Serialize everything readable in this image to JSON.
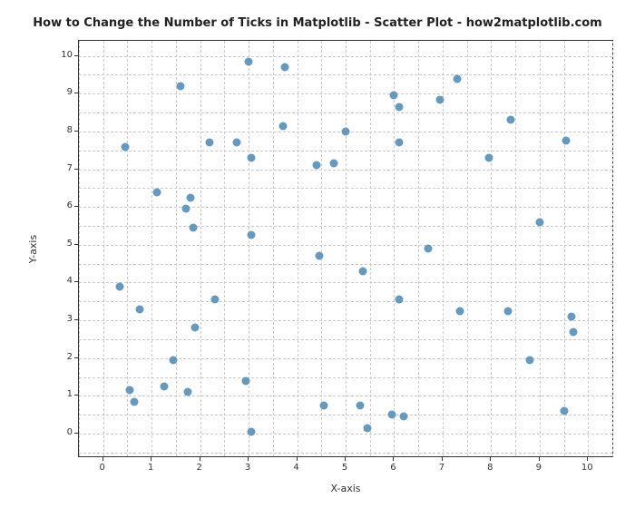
{
  "chart_data": {
    "type": "scatter",
    "title": "How to Change the Number of Ticks in Matplotlib - Scatter Plot - how2matplotlib.com",
    "xlabel": "X-axis",
    "ylabel": "Y-axis",
    "xlim": [
      -0.5,
      10.5
    ],
    "ylim": [
      -0.6,
      10.4
    ],
    "xticks": [
      0,
      1,
      2,
      3,
      4,
      5,
      6,
      7,
      8,
      9,
      10
    ],
    "yticks": [
      0,
      1,
      2,
      3,
      4,
      5,
      6,
      7,
      8,
      9,
      10
    ],
    "x_minor_step": 0.5,
    "y_minor_step": 0.5,
    "points": [
      {
        "x": 0.45,
        "y": 7.6
      },
      {
        "x": 0.35,
        "y": 3.9
      },
      {
        "x": 0.55,
        "y": 1.15
      },
      {
        "x": 0.65,
        "y": 0.85
      },
      {
        "x": 0.75,
        "y": 3.3
      },
      {
        "x": 1.1,
        "y": 6.4
      },
      {
        "x": 1.25,
        "y": 1.25
      },
      {
        "x": 1.45,
        "y": 1.95
      },
      {
        "x": 1.6,
        "y": 9.2
      },
      {
        "x": 1.7,
        "y": 5.95
      },
      {
        "x": 1.75,
        "y": 1.1
      },
      {
        "x": 1.8,
        "y": 6.25
      },
      {
        "x": 1.85,
        "y": 5.45
      },
      {
        "x": 1.9,
        "y": 2.8
      },
      {
        "x": 2.2,
        "y": 7.7
      },
      {
        "x": 2.3,
        "y": 3.55
      },
      {
        "x": 2.75,
        "y": 7.7
      },
      {
        "x": 2.95,
        "y": 1.4
      },
      {
        "x": 3.0,
        "y": 9.85
      },
      {
        "x": 3.05,
        "y": 7.3
      },
      {
        "x": 3.05,
        "y": 5.25
      },
      {
        "x": 3.05,
        "y": 0.05
      },
      {
        "x": 3.7,
        "y": 8.15
      },
      {
        "x": 3.75,
        "y": 9.7
      },
      {
        "x": 4.4,
        "y": 7.1
      },
      {
        "x": 4.45,
        "y": 4.7
      },
      {
        "x": 4.55,
        "y": 0.75
      },
      {
        "x": 4.75,
        "y": 7.15
      },
      {
        "x": 5.0,
        "y": 8.0
      },
      {
        "x": 5.3,
        "y": 0.75
      },
      {
        "x": 5.35,
        "y": 4.3
      },
      {
        "x": 5.45,
        "y": 0.15
      },
      {
        "x": 5.95,
        "y": 0.5
      },
      {
        "x": 6.0,
        "y": 8.95
      },
      {
        "x": 6.1,
        "y": 8.65
      },
      {
        "x": 6.1,
        "y": 7.7
      },
      {
        "x": 6.1,
        "y": 3.55
      },
      {
        "x": 6.2,
        "y": 0.45
      },
      {
        "x": 6.7,
        "y": 4.9
      },
      {
        "x": 6.95,
        "y": 8.85
      },
      {
        "x": 7.3,
        "y": 9.4
      },
      {
        "x": 7.35,
        "y": 3.25
      },
      {
        "x": 7.95,
        "y": 7.3
      },
      {
        "x": 8.35,
        "y": 3.25
      },
      {
        "x": 8.4,
        "y": 8.3
      },
      {
        "x": 8.8,
        "y": 1.95
      },
      {
        "x": 9.0,
        "y": 5.6
      },
      {
        "x": 9.5,
        "y": 0.6
      },
      {
        "x": 9.55,
        "y": 7.75
      },
      {
        "x": 9.65,
        "y": 3.1
      },
      {
        "x": 9.7,
        "y": 2.7
      }
    ]
  }
}
